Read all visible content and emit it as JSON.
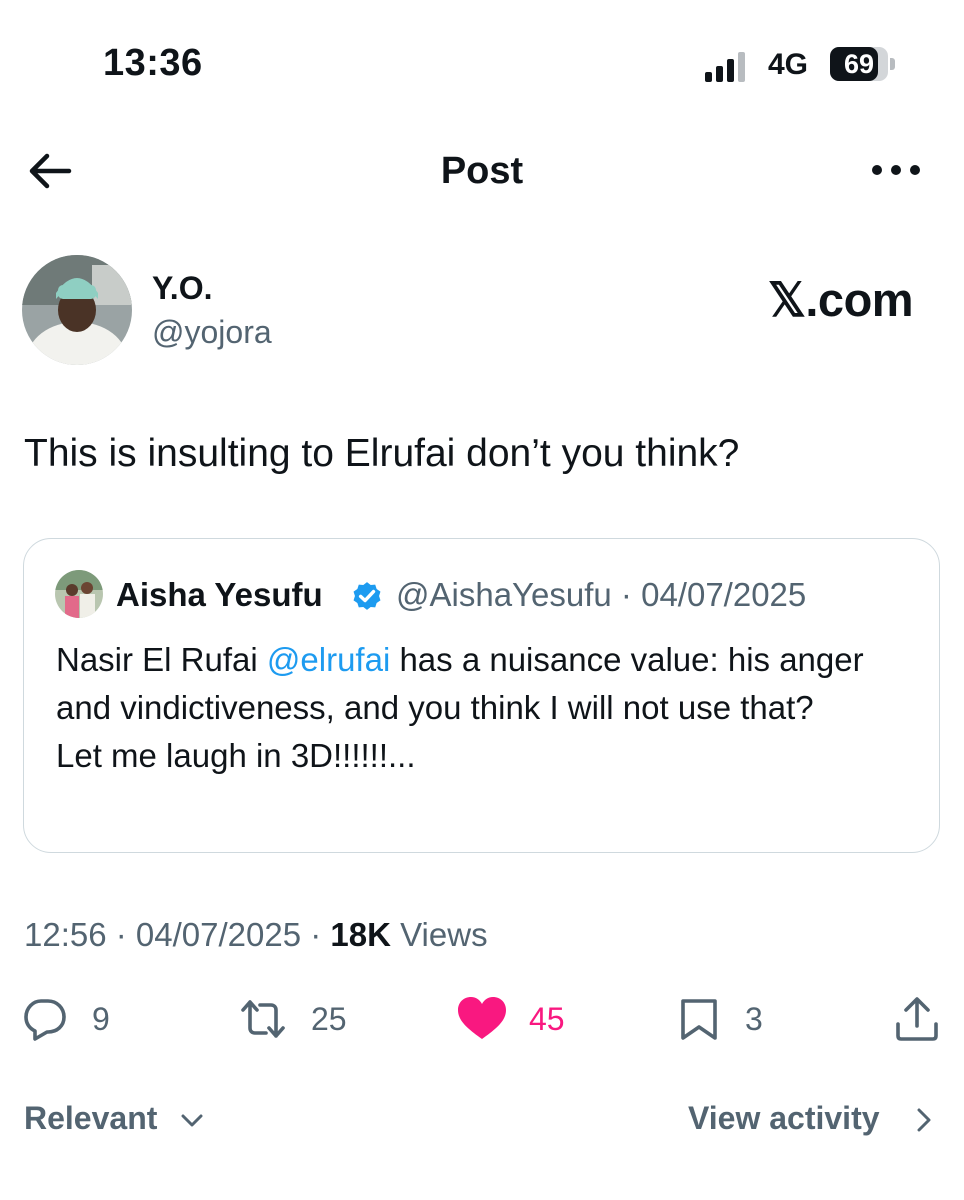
{
  "status_bar": {
    "time": "13:36",
    "network": "4G",
    "battery": "69"
  },
  "header": {
    "title": "Post"
  },
  "author": {
    "name": "Y.O.",
    "handle": "@yojora"
  },
  "watermark": "𝕏.com",
  "tweet": {
    "text": "This is insulting to Elrufai don’t you think?"
  },
  "quote": {
    "name": "Aisha Yesufu",
    "handle": "@AishaYesufu",
    "date": "04/07/2025",
    "body_before_mention": "Nasir El Rufai ",
    "mention": "@elrufai",
    "body_after_mention": " has a nuisance value: his anger and vindictiveness, and you think I will not use that?",
    "body_line2": "Let me laugh in 3D!!!!!!..."
  },
  "meta": {
    "time": "12:56",
    "date": "04/07/2025",
    "views_count": "18K",
    "views_label": "Views"
  },
  "actions": {
    "replies": "9",
    "reposts": "25",
    "likes": "45",
    "bookmarks": "3"
  },
  "footer": {
    "sort_label": "Relevant",
    "activity_label": "View activity"
  },
  "colors": {
    "accent": "#1d9bf0",
    "like": "#f91880",
    "secondary_text": "#536471"
  },
  "icons": [
    "back-arrow-icon",
    "more-icon",
    "verified-icon",
    "reply-icon",
    "repost-icon",
    "heart-icon",
    "bookmark-icon",
    "share-icon",
    "chevron-down-icon",
    "chevron-right-icon"
  ]
}
